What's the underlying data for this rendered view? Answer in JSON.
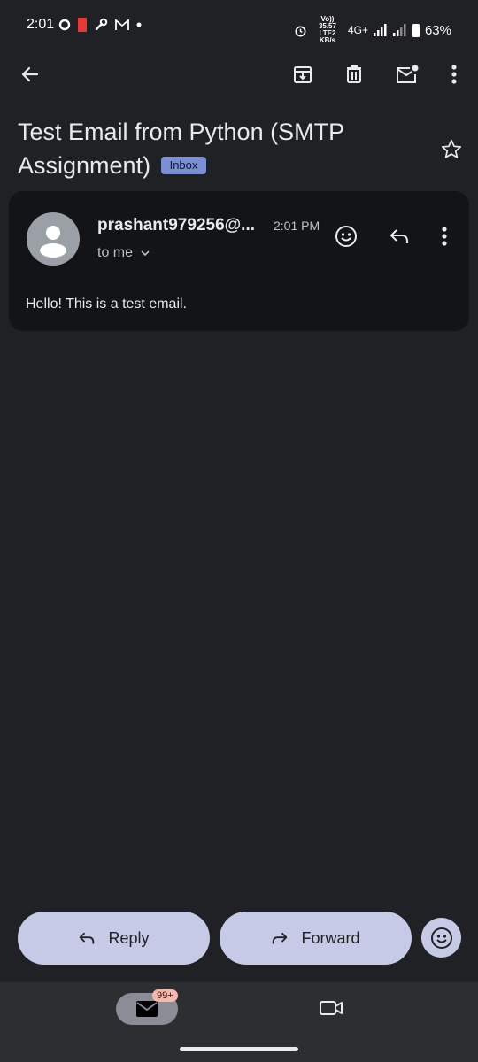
{
  "status_bar": {
    "time": "2:01",
    "net_line1": "Vo)) 35.57",
    "net_line2": "LTE2 KB/s",
    "network": "4G+",
    "battery": "63%"
  },
  "email": {
    "subject": "Test Email from Python (SMTP Assignment)",
    "label": "Inbox",
    "sender": "prashant979256@...",
    "time": "2:01 PM",
    "recipient": "to me",
    "body": "Hello! This is a test email."
  },
  "actions": {
    "reply_label": "Reply",
    "forward_label": "Forward"
  },
  "bottom_nav": {
    "mail_badge": "99+"
  },
  "colors": {
    "background": "#202124",
    "card": "#131417",
    "pill": "#c6cae7",
    "label_chip": "#7c8fd4"
  }
}
